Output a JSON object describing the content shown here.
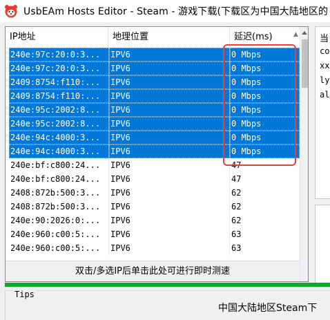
{
  "window": {
    "title": "UsbEAm Hosts Editor - Steam - 游戏下载(下载区为中国大陆地区的"
  },
  "list": {
    "columns": [
      "IP地址",
      "地理位置",
      "延迟(ms)"
    ],
    "rows": [
      {
        "ip": "240e:97c:20:0:3...",
        "location": "IPV6",
        "latency": "0 Mbps",
        "selected": true
      },
      {
        "ip": "240e:97c:20:0:3...",
        "location": "IPV6",
        "latency": "0 Mbps",
        "selected": true
      },
      {
        "ip": "2409:8754:f110:...",
        "location": "IPV6",
        "latency": "0 Mbps",
        "selected": true
      },
      {
        "ip": "2409:8754:f110:...",
        "location": "IPV6",
        "latency": "0 Mbps",
        "selected": true
      },
      {
        "ip": "240e:95c:2002:8...",
        "location": "IPV6",
        "latency": "0 Mbps",
        "selected": true
      },
      {
        "ip": "240e:95c:2002:8...",
        "location": "IPV6",
        "latency": "0 Mbps",
        "selected": true
      },
      {
        "ip": "240e:94c:4000:3...",
        "location": "IPV6",
        "latency": "0 Mbps",
        "selected": true
      },
      {
        "ip": "240e:94c:4000:3...",
        "location": "IPV6",
        "latency": "0 Mbps",
        "selected": true
      },
      {
        "ip": "240e:bf:c800:24...",
        "location": "IPV6",
        "latency": "47",
        "selected": false
      },
      {
        "ip": "240e:bf:c800:24...",
        "location": "IPV6",
        "latency": "47",
        "selected": false
      },
      {
        "ip": "2408:872b:500:3...",
        "location": "IPV6",
        "latency": "62",
        "selected": false
      },
      {
        "ip": "2408:872b:500:3...",
        "location": "IPV6",
        "latency": "62",
        "selected": false
      },
      {
        "ip": "240e:90:2026:0:...",
        "location": "IPV6",
        "latency": "62",
        "selected": false
      },
      {
        "ip": "240e:960:c00:5:...",
        "location": "IPV6",
        "latency": "63",
        "selected": false
      },
      {
        "ip": "240e:960:c00:5:...",
        "location": "IPV6",
        "latency": "63",
        "selected": false
      }
    ],
    "speedtest_hint": "双击/多选IP后单击此处可进行即时测速"
  },
  "right_panel": {
    "header": "当",
    "lines": [
      "co",
      "xx",
      "ly",
      "al"
    ]
  },
  "tips": {
    "label": "Tips",
    "text": "中国大陆地区Steam下"
  },
  "colors": {
    "selection": "#0078d7",
    "highlight": "#e8403a",
    "progress": "#06b025"
  }
}
